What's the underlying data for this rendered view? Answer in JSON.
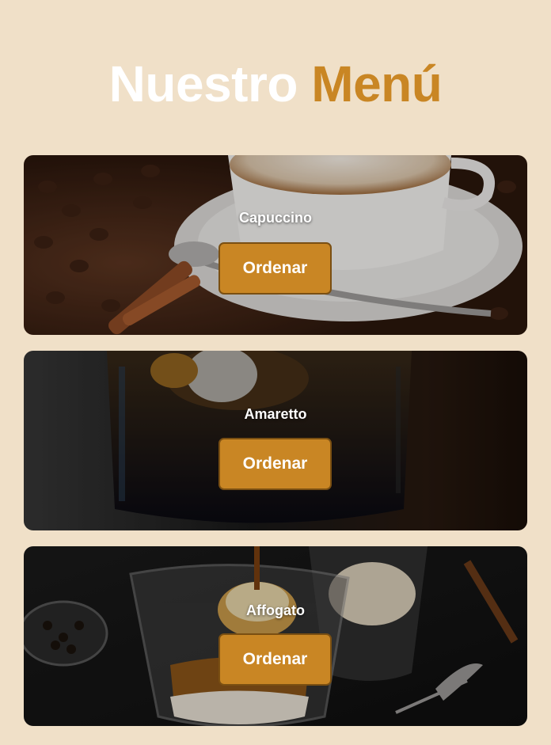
{
  "header": {
    "title_part1": "Nuestro",
    "title_part2": "Menú"
  },
  "menu": {
    "items": [
      {
        "name": "Capuccino",
        "button_label": "Ordenar"
      },
      {
        "name": "Amaretto",
        "button_label": "Ordenar"
      },
      {
        "name": "Affogato",
        "button_label": "Ordenar"
      }
    ]
  },
  "colors": {
    "background": "#f0e0c8",
    "accent": "#c98624",
    "title_white": "#ffffff"
  }
}
